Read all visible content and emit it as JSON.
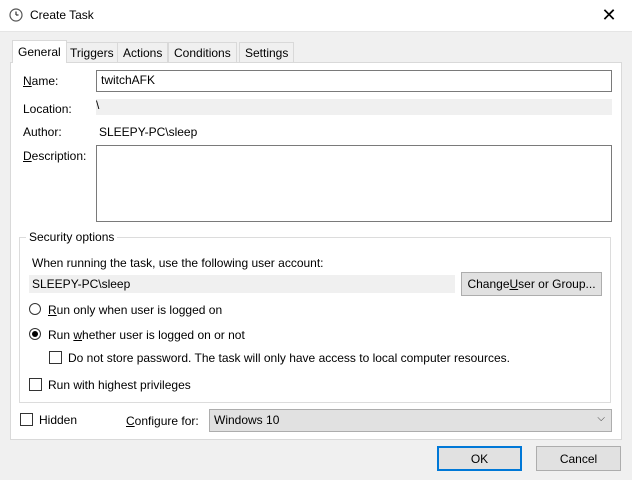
{
  "window": {
    "title": "Create Task",
    "close_glyph": "✕"
  },
  "tabs": [
    {
      "label": "General"
    },
    {
      "label": "Triggers"
    },
    {
      "label": "Actions"
    },
    {
      "label": "Conditions"
    },
    {
      "label": "Settings"
    }
  ],
  "general": {
    "name_label_u": "N",
    "name_label_rest": "ame:",
    "name_value": "twitchAFK",
    "location_label": "Location:",
    "location_value": "\\",
    "author_label": "Author:",
    "author_value": "SLEEPY-PC\\sleep",
    "description_label_u": "D",
    "description_label_rest": "escription:",
    "description_value": ""
  },
  "security": {
    "group_title": "Security options",
    "account_prompt": "When running the task, use the following user account:",
    "account_value": "SLEEPY-PC\\sleep",
    "change_button_pre": "Change ",
    "change_button_u": "U",
    "change_button_post": "ser or Group...",
    "radio_logged_on_u": "R",
    "radio_logged_on_rest": "un only when user is logged on",
    "radio_logged_on_selected": false,
    "radio_whether_pre": "Run ",
    "radio_whether_u": "w",
    "radio_whether_post": "hether user is logged on or not",
    "radio_whether_selected": true,
    "no_store_password_label": "Do not store password.  The task will only have access to local computer resources.",
    "no_store_password_checked": false,
    "highest_privileges_pre": "Run with highest privileges",
    "highest_privileges_checked": false
  },
  "footer": {
    "hidden_label": "Hidden",
    "hidden_checked": false,
    "configure_label_u": "C",
    "configure_label_rest": "onfigure for:",
    "configure_value": "Windows 10",
    "ok_label": "OK",
    "cancel_label": "Cancel"
  },
  "icons": {
    "title_icon": "clock-icon",
    "close_icon": "close-icon",
    "dropdown_icon": "chevron-down-icon"
  }
}
